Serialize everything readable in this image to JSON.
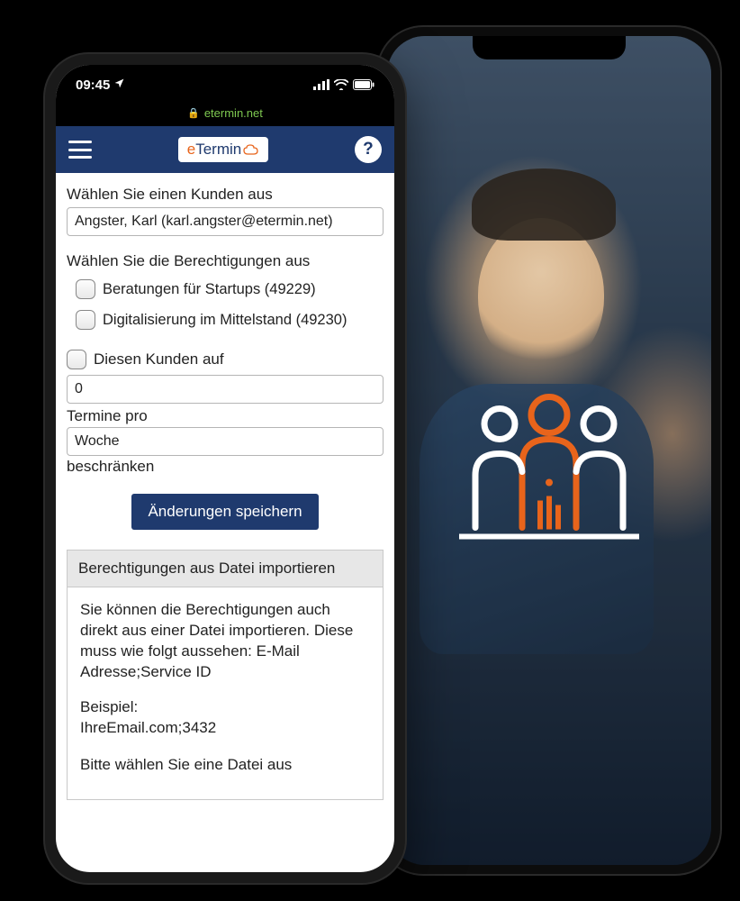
{
  "status": {
    "time": "09:45",
    "domain": "etermin.net"
  },
  "header": {
    "logo_e": "e",
    "logo_rest": "Termin",
    "help_symbol": "?"
  },
  "form": {
    "customer_label": "Wählen Sie einen Kunden aus",
    "customer_value": "Angster, Karl (karl.angster@etermin.net)",
    "permissions_label": "Wählen Sie die Berechtigungen aus",
    "permissions": [
      {
        "label": "Beratungen für Startups (49229)",
        "checked": false
      },
      {
        "label": "Digitalisierung im Mittelstand (49230)",
        "checked": false
      }
    ],
    "limit_checkbox_label": "Diesen Kunden auf",
    "limit_value": "0",
    "limit_per_label": "Termine pro",
    "limit_period_value": "Woche",
    "limit_suffix": "beschränken",
    "save_button": "Änderungen speichern"
  },
  "import_panel": {
    "title": "Berechtigungen aus Datei importieren",
    "body1": "Sie können die Berechtigungen auch direkt aus einer Datei importieren. Diese muss wie folgt aussehen: E-Mail Adresse;Service ID",
    "body2": "Beispiel:",
    "body3": "IhreEmail.com;3432",
    "body4": "Bitte wählen Sie eine Datei aus"
  }
}
